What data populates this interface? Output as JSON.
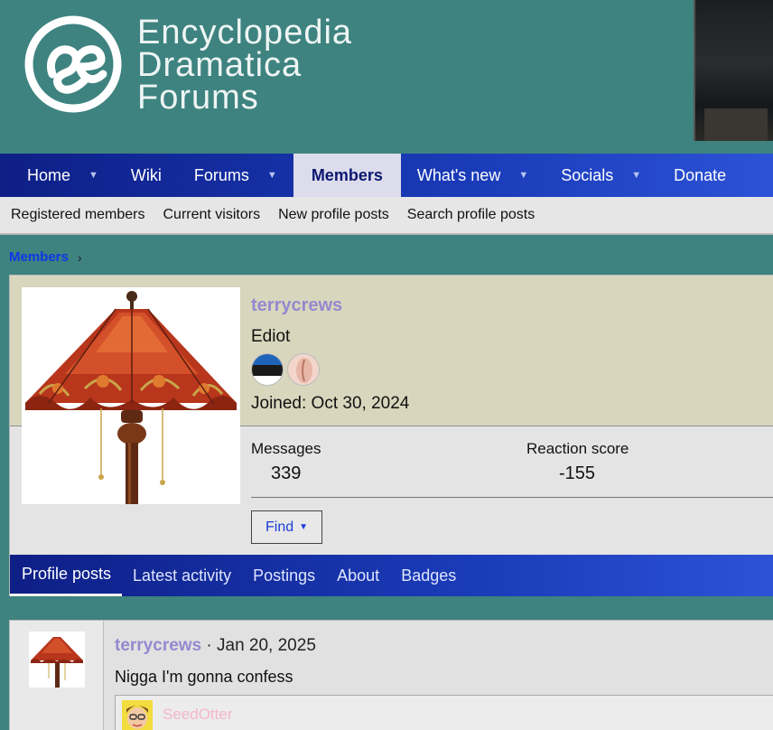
{
  "header": {
    "logo_lines": [
      "Encyclopedia",
      "Dramatica",
      "Forums"
    ]
  },
  "nav": {
    "items": [
      {
        "label": "Home",
        "has_dropdown": true
      },
      {
        "label": "Wiki",
        "has_dropdown": false
      },
      {
        "label": "Forums",
        "has_dropdown": true
      },
      {
        "label": "Members",
        "has_dropdown": false,
        "active": true
      },
      {
        "label": "What's new",
        "has_dropdown": true
      },
      {
        "label": "Socials",
        "has_dropdown": true
      },
      {
        "label": "Donate",
        "has_dropdown": false
      }
    ],
    "caret_glyph": "▼"
  },
  "subnav": {
    "items": [
      "Registered members",
      "Current visitors",
      "New profile posts",
      "Search profile posts"
    ]
  },
  "breadcrumb": {
    "items": [
      "Members"
    ],
    "separator": "›"
  },
  "profile": {
    "username": "terrycrews",
    "user_title": "Ediot",
    "joined": "Joined: Oct 30, 2024",
    "stats": {
      "messages_label": "Messages",
      "messages_value": "339",
      "reaction_label": "Reaction score",
      "reaction_value": "-155"
    },
    "find_label": "Find",
    "find_caret": "▼",
    "badges": [
      "estonia-flag-badge",
      "peach-badge"
    ],
    "avatar_icon": "tiffany-lamp-image"
  },
  "tabs": {
    "items": [
      "Profile posts",
      "Latest activity",
      "Postings",
      "About",
      "Badges"
    ],
    "active_index": 0
  },
  "post": {
    "author": "terrycrews",
    "separator": " · ",
    "date": "Jan 20, 2025",
    "body": "Nigga I'm gonna confess",
    "reply_author": "SeedOtter",
    "reply_avatar_icon": "cartoon-avatar"
  },
  "colors": {
    "nav_start": "#0e1f86",
    "nav_end": "#2c52d6",
    "header_bg": "#3e8380",
    "username": "#9489cf",
    "link": "#1235e6",
    "card_top": "#d8d6bd"
  }
}
